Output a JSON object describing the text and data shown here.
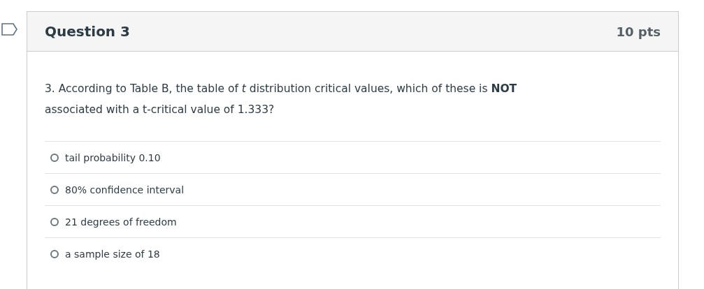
{
  "question": {
    "title": "Question 3",
    "points": "10 pts",
    "text": "3. According to Table B, the table of *t* distribution critical values, which of these is **NOT** associated with a t-critical value of 1.333?",
    "answers": [
      {
        "label": "tail probability 0.10",
        "selected": false
      },
      {
        "label": "80% confidence interval",
        "selected": false
      },
      {
        "label": "21 degrees of freedom",
        "selected": false
      },
      {
        "label": "a sample size of 18",
        "selected": false
      }
    ]
  }
}
